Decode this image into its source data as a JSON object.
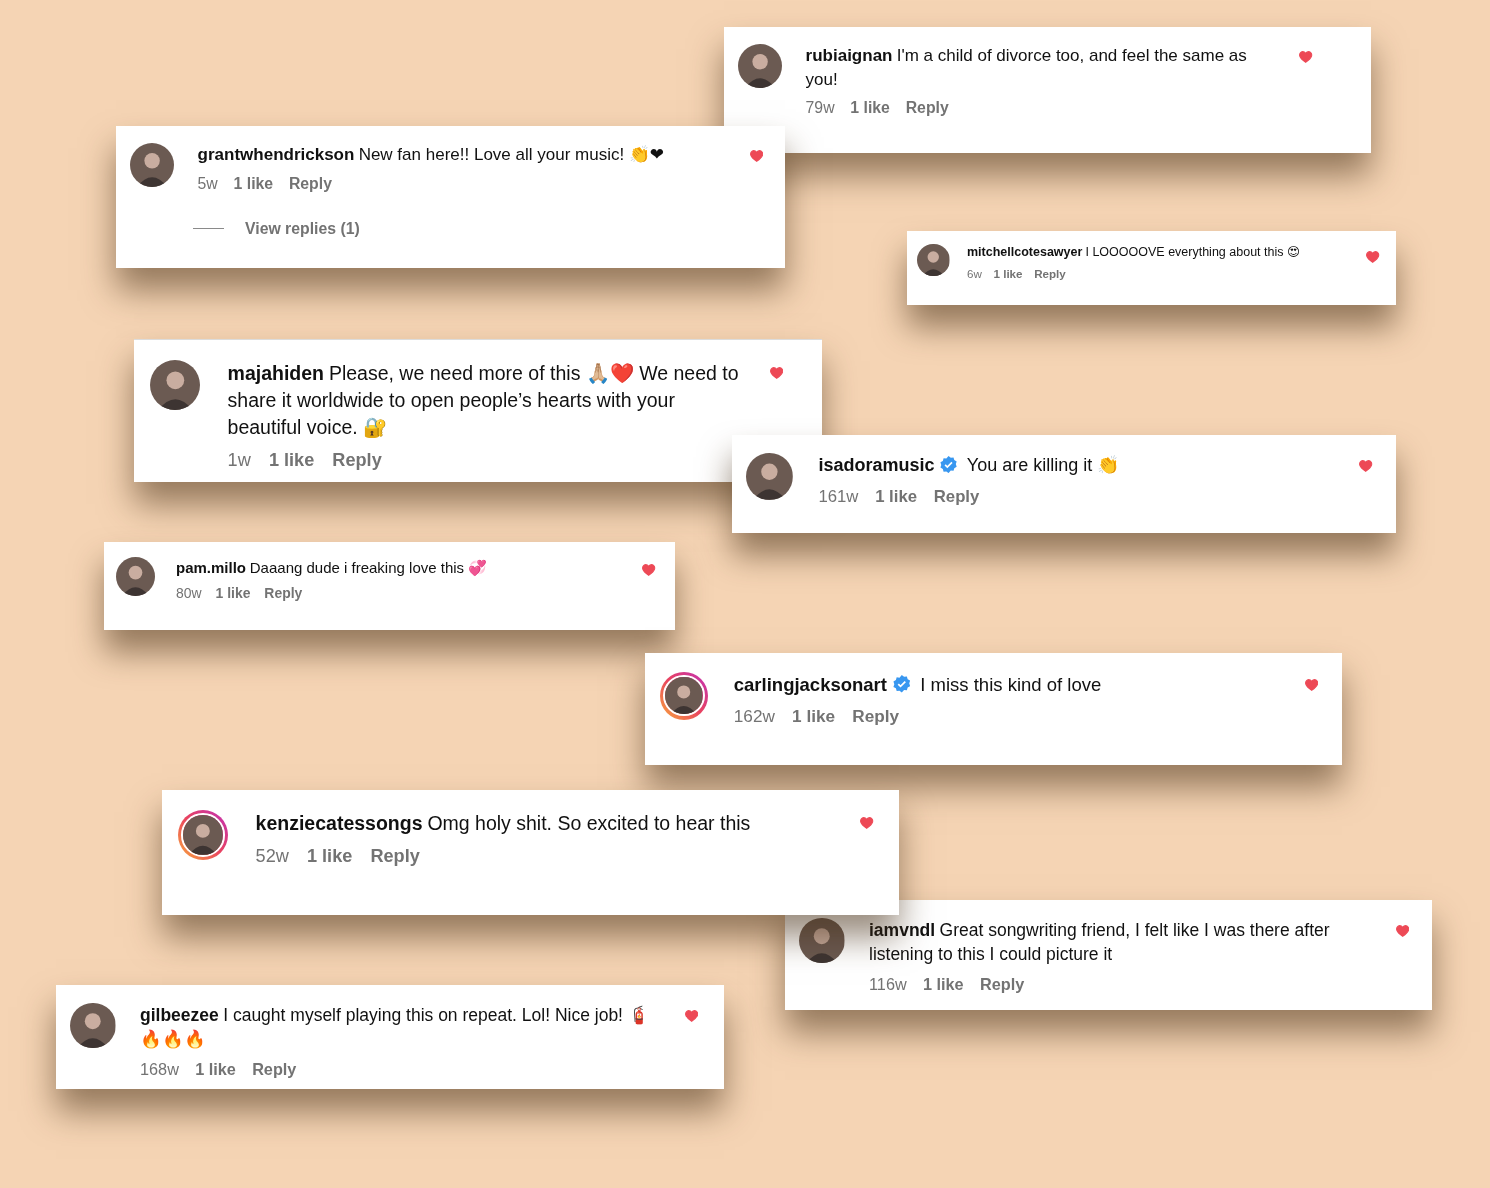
{
  "comments": [
    {
      "username": "rubiaignan",
      "verified": false,
      "story_ring": false,
      "text": "I'm a child of divorce too, and feel the same as you!",
      "age": "79w",
      "likes": "1 like",
      "reply": "Reply",
      "liked": true
    },
    {
      "username": "grantwhendrickson",
      "verified": false,
      "story_ring": false,
      "text": "New fan here!! Love all your music! 👏❤",
      "age": "5w",
      "likes": "1 like",
      "reply": "Reply",
      "liked": true,
      "view_replies": "View replies (1)"
    },
    {
      "username": "mitchellcotesawyer",
      "verified": false,
      "story_ring": false,
      "text": "I LOOOOOVE everything about this 😍",
      "age": "6w",
      "likes": "1 like",
      "reply": "Reply",
      "liked": true
    },
    {
      "username": "majahiden",
      "verified": false,
      "story_ring": false,
      "text": "Please, we need more of this 🙏🏼❤️ We need to share it worldwide to open people’s hearts with your beautiful voice. 🔐",
      "age": "1w",
      "likes": "1 like",
      "reply": "Reply",
      "liked": true
    },
    {
      "username": "isadoramusic",
      "verified": true,
      "story_ring": false,
      "text": "You are killing it 👏",
      "age": "161w",
      "likes": "1 like",
      "reply": "Reply",
      "liked": true
    },
    {
      "username": "pam.millo",
      "verified": false,
      "story_ring": false,
      "text": "Daaang dude i freaking love this 💞",
      "age": "80w",
      "likes": "1 like",
      "reply": "Reply",
      "liked": true
    },
    {
      "username": "carlingjacksonart",
      "verified": true,
      "story_ring": true,
      "text": "I miss this kind of love",
      "age": "162w",
      "likes": "1 like",
      "reply": "Reply",
      "liked": true
    },
    {
      "username": "kenziecatessongs",
      "verified": false,
      "story_ring": true,
      "text": "Omg holy shit. So excited to hear this",
      "age": "52w",
      "likes": "1 like",
      "reply": "Reply",
      "liked": true
    },
    {
      "username": "iamvndl",
      "verified": false,
      "story_ring": false,
      "text": "Great songwriting friend, I felt like I was there after listening to this I could picture it",
      "age": "116w",
      "likes": "1 like",
      "reply": "Reply",
      "liked": true
    },
    {
      "username": "gilbeezee",
      "verified": false,
      "story_ring": false,
      "text": "I caught myself playing this on repeat. Lol! Nice job! 🧯🔥🔥🔥",
      "age": "168w",
      "likes": "1 like",
      "reply": "Reply",
      "liked": true
    }
  ]
}
